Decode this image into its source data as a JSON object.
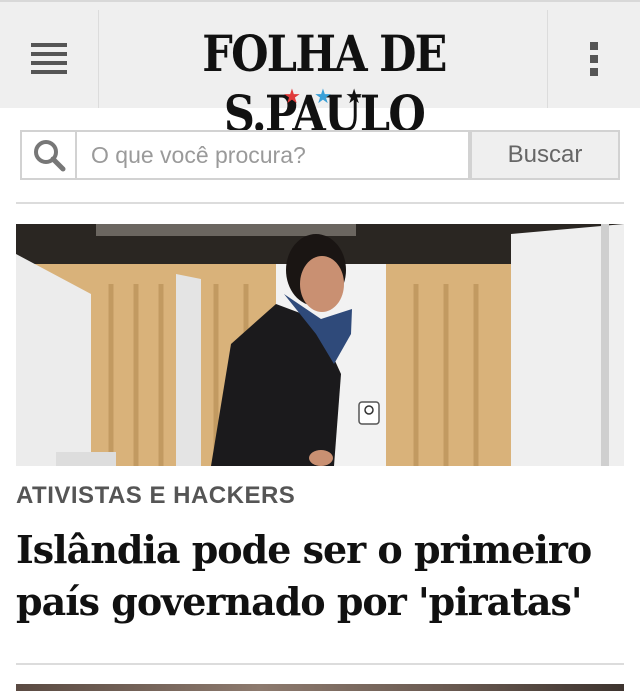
{
  "header": {
    "brand": "FOLHA DE S.PAULO",
    "stars": [
      {
        "glyph": "★",
        "color": "#e03a3a"
      },
      {
        "glyph": "★",
        "color": "#3aa0d8"
      },
      {
        "glyph": "★",
        "color": "#111111"
      }
    ],
    "menu_icon": "hamburger-icon",
    "more_icon": "vertical-dots-icon"
  },
  "search": {
    "icon": "search-icon",
    "placeholder": "O que você procura?",
    "button_label": "Buscar"
  },
  "article": {
    "image_alt": "woman at polling booth",
    "kicker": "ATIVISTAS E HACKERS",
    "headline": "Islândia pode ser o primeiro país governado por 'piratas'"
  },
  "colors": {
    "header_bg": "#efefef",
    "kicker": "#555555",
    "headline": "#111111"
  }
}
